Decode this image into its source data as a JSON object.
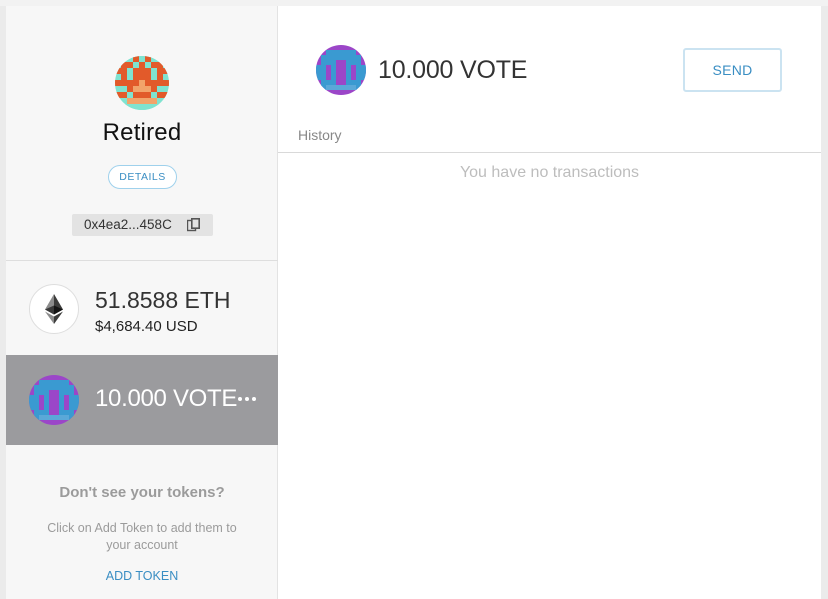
{
  "account": {
    "name": "Retired",
    "details_label": "DETAILS",
    "address_short": "0x4ea2...458C"
  },
  "tokens": [
    {
      "amount": "51.8588 ETH",
      "fiat": "$4,684.40 USD",
      "icon": "ethereum-icon"
    },
    {
      "amount": "10.000 VOTE",
      "icon": "vote-token-identicon"
    }
  ],
  "add_token_prompt": {
    "heading": "Don't see your tokens?",
    "body": "Click on Add Token to add them to your account",
    "link": "ADD TOKEN"
  },
  "main": {
    "amount": "10.000 VOTE",
    "send_label": "SEND",
    "history_label": "History",
    "empty_message": "You have no transactions"
  },
  "colors": {
    "accent": "#3a8ec3",
    "selected_row": "#9b9b9e",
    "sidebar_bg": "#f7f7f7"
  },
  "icons": {
    "more": "more-dots-icon",
    "copy": "copy-icon"
  }
}
